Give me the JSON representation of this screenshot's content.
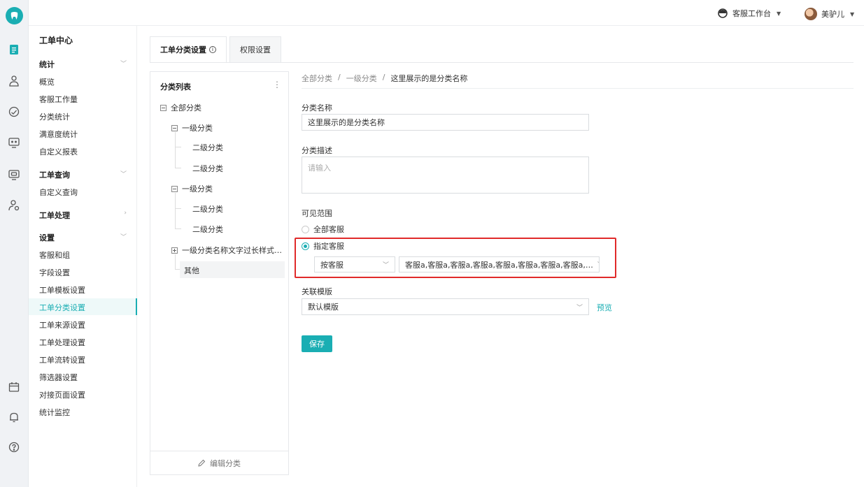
{
  "header": {
    "workbench_label": "客服工作台",
    "user_name": "美驴儿"
  },
  "nav": {
    "title": "工单中心",
    "sections": {
      "stats": "统计",
      "query": "工单查询",
      "process": "工单处理",
      "settings": "设置"
    },
    "stats_items": [
      "概览",
      "客服工作量",
      "分类统计",
      "满意度统计",
      "自定义报表"
    ],
    "query_items": [
      "自定义查询"
    ],
    "settings_items": [
      "客服和组",
      "字段设置",
      "工单模板设置",
      "工单分类设置",
      "工单来源设置",
      "工单处理设置",
      "工单流转设置",
      "筛选器设置",
      "对接页面设置",
      "统计监控"
    ]
  },
  "tabs": [
    "工单分类设置",
    "权限设置"
  ],
  "tab_info_glyph": "i",
  "category_panel": {
    "title": "分类列表",
    "more_glyph": "⋮",
    "root": "全部分类",
    "level1_a": "一级分类",
    "level2_a1": "二级分类",
    "level2_a2": "二级分类",
    "level1_b": "一级分类",
    "level2_b1": "二级分类",
    "level2_b2": "二级分类",
    "level1_long": "一级分类名称文字过长样式…",
    "other": "其他",
    "footer_label": "编辑分类"
  },
  "breadcrumb": {
    "items": [
      "全部分类",
      "一级分类",
      "这里展示的是分类名称"
    ],
    "sep": "/"
  },
  "form": {
    "name_label": "分类名称",
    "name_value": "这里展示的是分类名称",
    "desc_label": "分类描述",
    "desc_placeholder": "请输入",
    "scope_label": "可见范围",
    "scope_all": "全部客服",
    "scope_specified": "指定客服",
    "by_select": "按客服",
    "agents_select": "客服a,客服a,客服a,客服a,客服a,客服a,客服a,客服a,…",
    "template_label": "关联模版",
    "template_value": "默认模版",
    "preview_label": "预览",
    "save_label": "保存"
  },
  "colors": {
    "accent": "#1aaeb3",
    "highlight": "#e02a2a"
  }
}
